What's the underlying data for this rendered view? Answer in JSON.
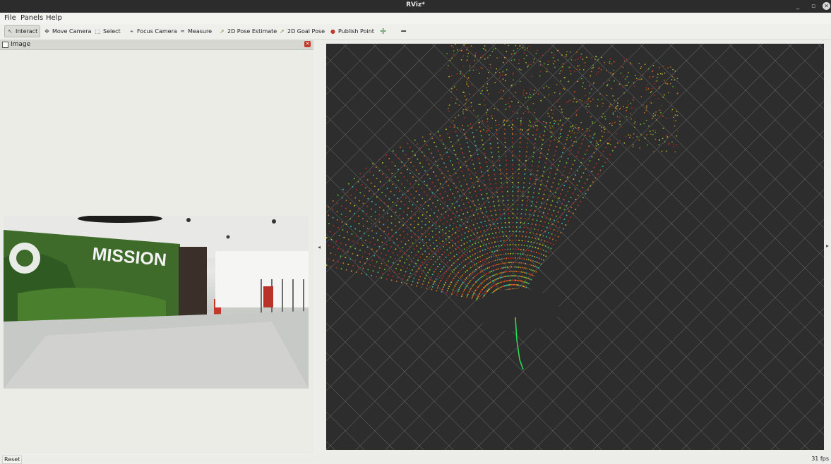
{
  "window": {
    "title": "RViz*",
    "min_glyph": "_",
    "max_glyph": "▫",
    "close_glyph": "✕"
  },
  "menubar": {
    "file": "File",
    "panels": "Panels",
    "help": "Help"
  },
  "toolbar": {
    "interact": "Interact",
    "move_camera": "Move Camera",
    "select": "Select",
    "focus_camera": "Focus Camera",
    "measure": "Measure",
    "pose_estimate": "2D Pose Estimate",
    "goal_pose": "2D Goal Pose",
    "publish_point": "Publish Point",
    "add_glyph": "✛",
    "remove_glyph": "━"
  },
  "image_panel": {
    "title": "Image",
    "close_glyph": "✕",
    "camera_sign_text": "MISSION"
  },
  "splitter": {
    "left_arrow": "◂",
    "right_arrow": "▸"
  },
  "statusbar": {
    "reset_label": "Reset",
    "fps": "31 fps"
  },
  "icons": {
    "interact": "cursor-icon",
    "move_camera": "move-icon",
    "select": "select-box-icon",
    "focus_camera": "focus-icon",
    "measure": "ruler-icon",
    "pose_estimate": "green-arrow-icon",
    "goal_pose": "green-arrow-icon",
    "publish_point": "map-pin-icon"
  },
  "colors": {
    "grid": "#8a8a8a",
    "viewport_bg": "#2d2d2d",
    "point_red": "#c8301e",
    "point_orange": "#e07a1f",
    "point_yellow": "#d4d21f",
    "point_green": "#6ed12a",
    "point_cyan": "#3fc7b4",
    "path": "#2ee05a"
  }
}
